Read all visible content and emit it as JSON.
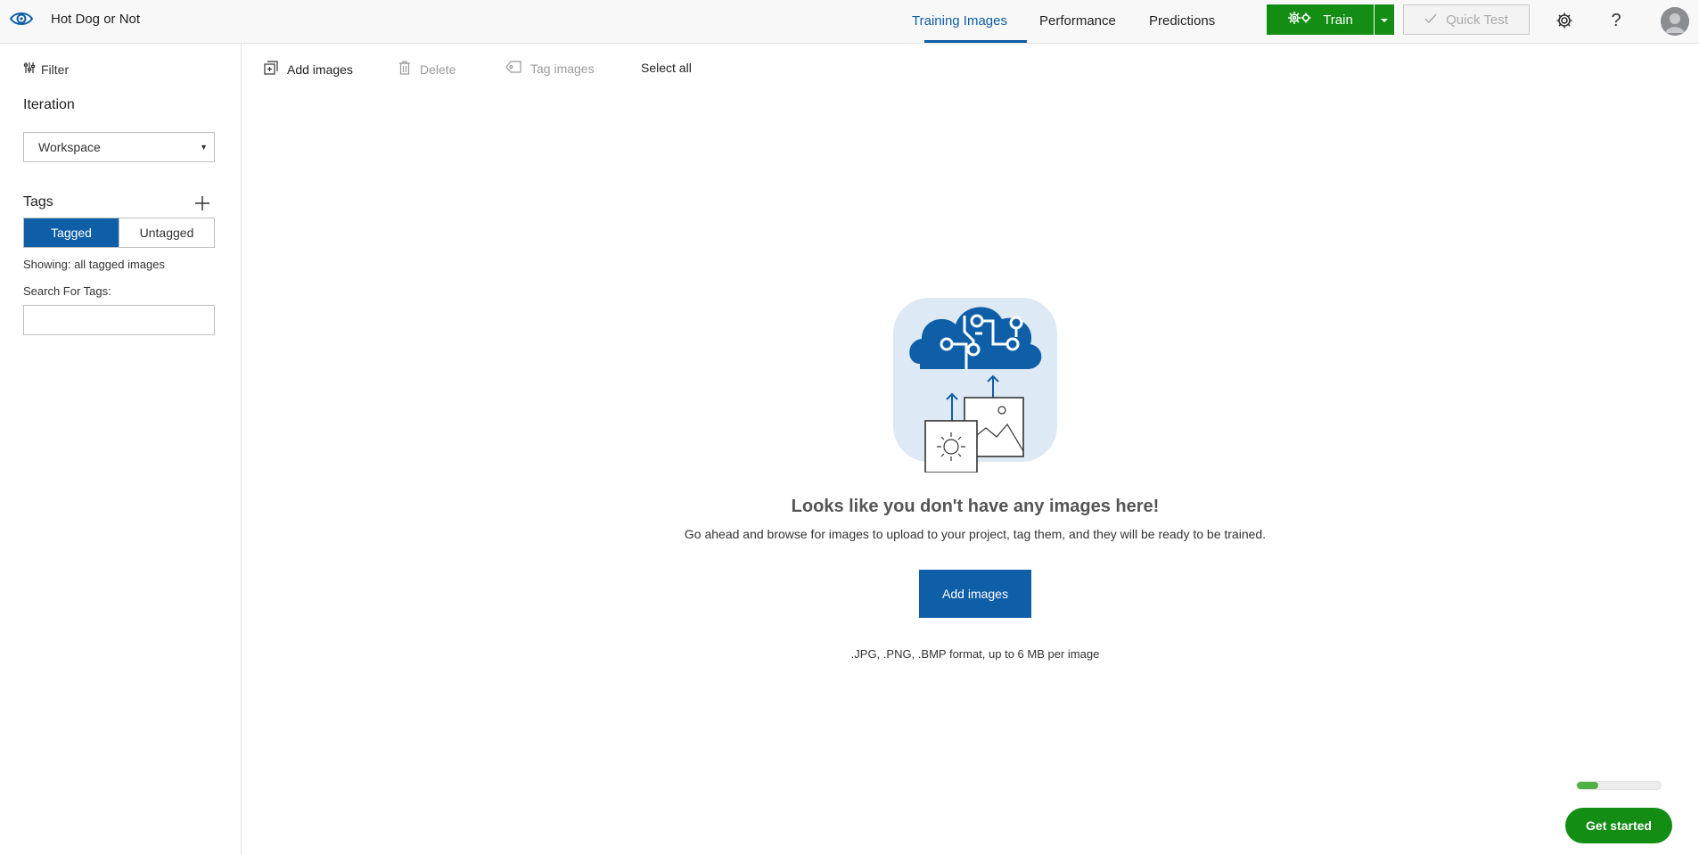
{
  "header": {
    "app_title": "Hot Dog or Not",
    "nav": [
      {
        "label": "Training Images",
        "active": true
      },
      {
        "label": "Performance",
        "active": false
      },
      {
        "label": "Predictions",
        "active": false
      }
    ],
    "train_label": "Train",
    "quick_test_label": "Quick Test",
    "icons": [
      "eye-logo-icon",
      "settings-icon",
      "help-icon",
      "avatar"
    ]
  },
  "sidebar": {
    "filter_label": "Filter",
    "iteration_title": "Iteration",
    "iteration_value": "Workspace",
    "tags_title": "Tags",
    "tag_filter": {
      "tagged": "Tagged",
      "untagged": "Untagged",
      "selected": "Tagged"
    },
    "showing_text": "Showing: all tagged images",
    "search_label": "Search For Tags:",
    "search_value": ""
  },
  "toolbar": {
    "add_images": "Add images",
    "delete": "Delete",
    "tag_images": "Tag images",
    "select_all": "Select all"
  },
  "empty_state": {
    "title": "Looks like you don't have any images here!",
    "description": "Go ahead and browse for images to upload to your project, tag them, and they will be ready to be trained.",
    "button_label": "Add images",
    "formats_note": ".JPG, .PNG, .BMP format, up to 6 MB per image"
  },
  "get_started": {
    "label": "Get started",
    "progress_fraction": 0.25
  },
  "colors": {
    "accent_blue": "#0f5ea8",
    "train_green": "#138d14",
    "progress_green": "#4fb143"
  }
}
